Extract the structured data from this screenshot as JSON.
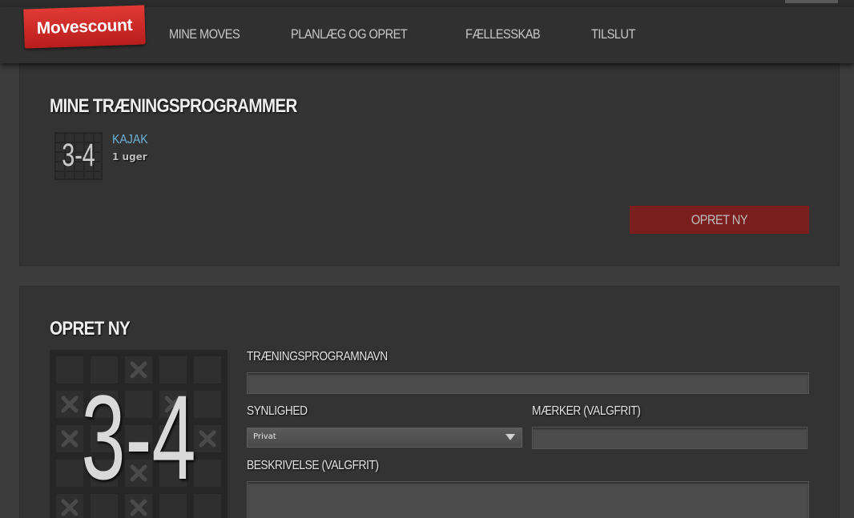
{
  "header": {
    "logo_text": "Movescount",
    "nav": [
      {
        "label": "MINE MOVES"
      },
      {
        "label": "PLANLÆG OG OPRET"
      },
      {
        "label": "FÆLLESSKAB"
      },
      {
        "label": "TILSLUT"
      }
    ]
  },
  "programs_section": {
    "title": "MINE TRÆNINGSPROGRAMMER",
    "programs": [
      {
        "name": "KAJAK",
        "weeks": "1 uger",
        "thumb_text": "3-4"
      }
    ],
    "create_button": "OPRET NY"
  },
  "create_section": {
    "title": "OPRET NY",
    "thumb_text": "3-4",
    "name_label": "TRÆNINGSPROGRAMNAVN",
    "name_value": "",
    "visibility_label": "SYNLIGHED",
    "visibility_value": "Privat",
    "tags_label": "MÆRKER (VALGFRIT)",
    "tags_value": "",
    "description_label": "BESKRIVELSE (VALGFRIT)",
    "description_value": ""
  },
  "colors": {
    "brand_red": "#d42f2c",
    "button_red": "#7a1f1d",
    "link_blue": "#6db3d8",
    "background": "#3c3c3c",
    "panel": "#333333"
  },
  "icons": {
    "program_thumb": "grid-3-4-icon",
    "dropdown": "chevron-down-icon"
  }
}
